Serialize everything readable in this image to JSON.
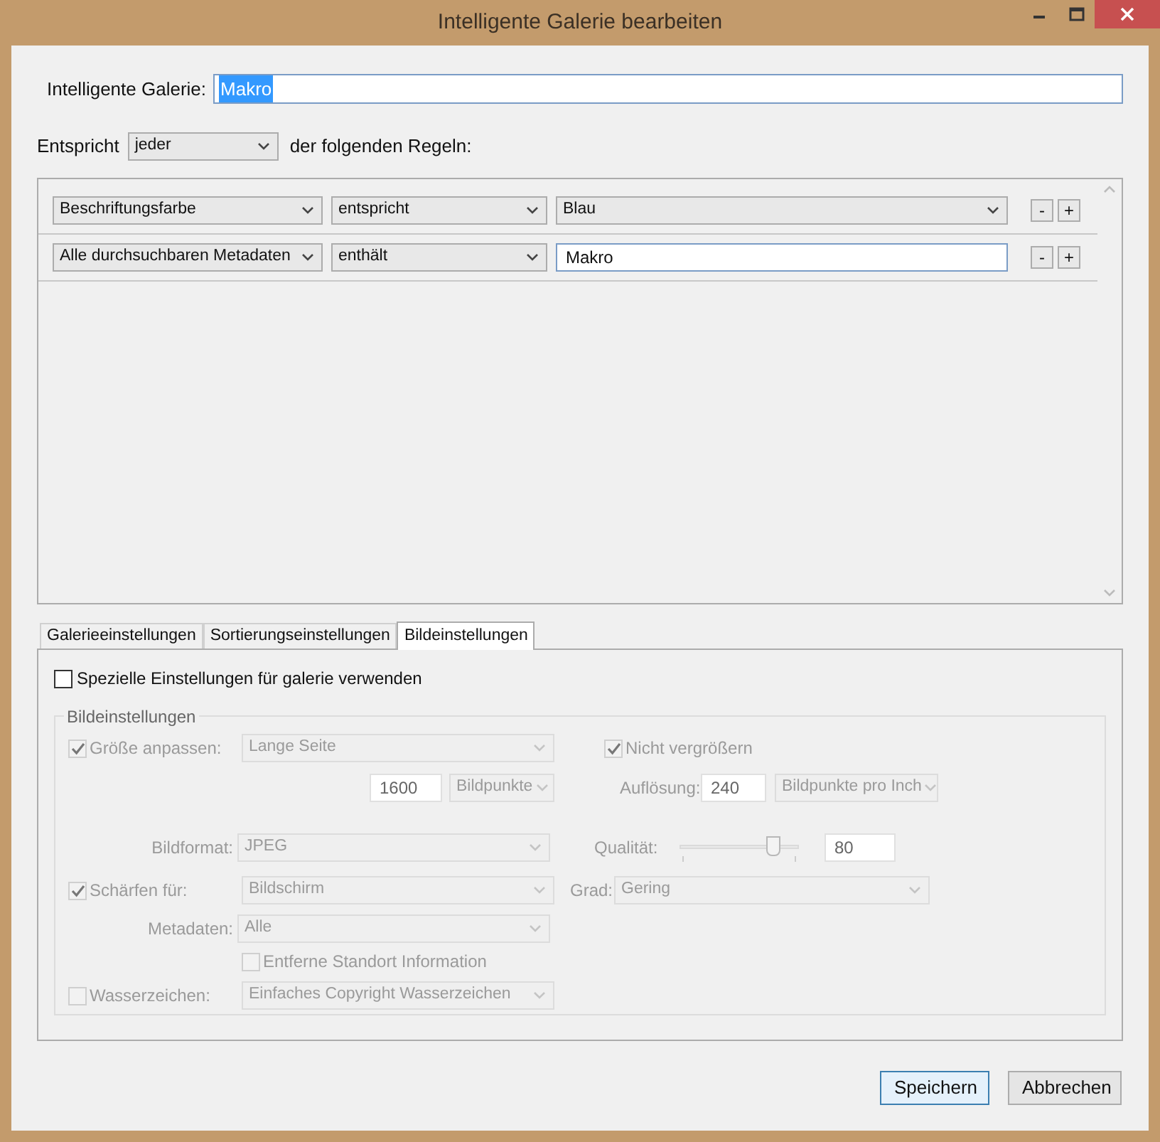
{
  "window": {
    "title": "Intelligente Galerie bearbeiten"
  },
  "gallery_name": {
    "label": "Intelligente Galerie:",
    "value": "Makro"
  },
  "match": {
    "prefix": "Entspricht",
    "value": "jeder",
    "suffix": "der folgenden Regeln:"
  },
  "rules": [
    {
      "field": "Beschriftungsfarbe",
      "operator": "entspricht",
      "value": "Blau",
      "kind": "dropdown",
      "remove": "-",
      "add": "+"
    },
    {
      "field": "Alle durchsuchbaren Metadaten",
      "operator": "enthält",
      "value": "Makro",
      "kind": "text",
      "remove": "-",
      "add": "+"
    }
  ],
  "tabs": [
    {
      "label": "Galerieeinstellungen",
      "selected": false
    },
    {
      "label": "Sortierungseinstellungen",
      "selected": false
    },
    {
      "label": "Bildeinstellungen",
      "selected": true
    }
  ],
  "use_special": {
    "label": "Spezielle Einstellungen für galerie verwenden",
    "checked": false
  },
  "image_settings": {
    "title": "Bildeinstellungen",
    "disabled": true,
    "resize": {
      "label": "Größe anpassen:",
      "checked": true,
      "value": "Lange Seite",
      "size": "1600",
      "unit": "Bildpunkte"
    },
    "no_enlarge": {
      "label": "Nicht vergrößern",
      "checked": true
    },
    "resolution": {
      "label": "Auflösung:",
      "value": "240",
      "unit": "Bildpunkte pro Inch"
    },
    "format": {
      "label": "Bildformat:",
      "value": "JPEG"
    },
    "quality": {
      "label": "Qualität:",
      "level": 0.78,
      "value": "80"
    },
    "sharpen": {
      "label": "Schärfen für:",
      "checked": true,
      "value": "Bildschirm"
    },
    "amount": {
      "label": "Grad:",
      "value": "Gering"
    },
    "metadata": {
      "label": "Metadaten:",
      "value": "Alle"
    },
    "remove_location": {
      "label": "Entferne Standort Information",
      "checked": false
    },
    "watermark": {
      "label": "Wasserzeichen:",
      "checked": false,
      "value": "Einfaches Copyright Wasserzeichen"
    }
  },
  "buttons": [
    {
      "label": "Speichern",
      "kind": "primary"
    },
    {
      "label": "Abbrechen",
      "kind": "secondary"
    }
  ]
}
